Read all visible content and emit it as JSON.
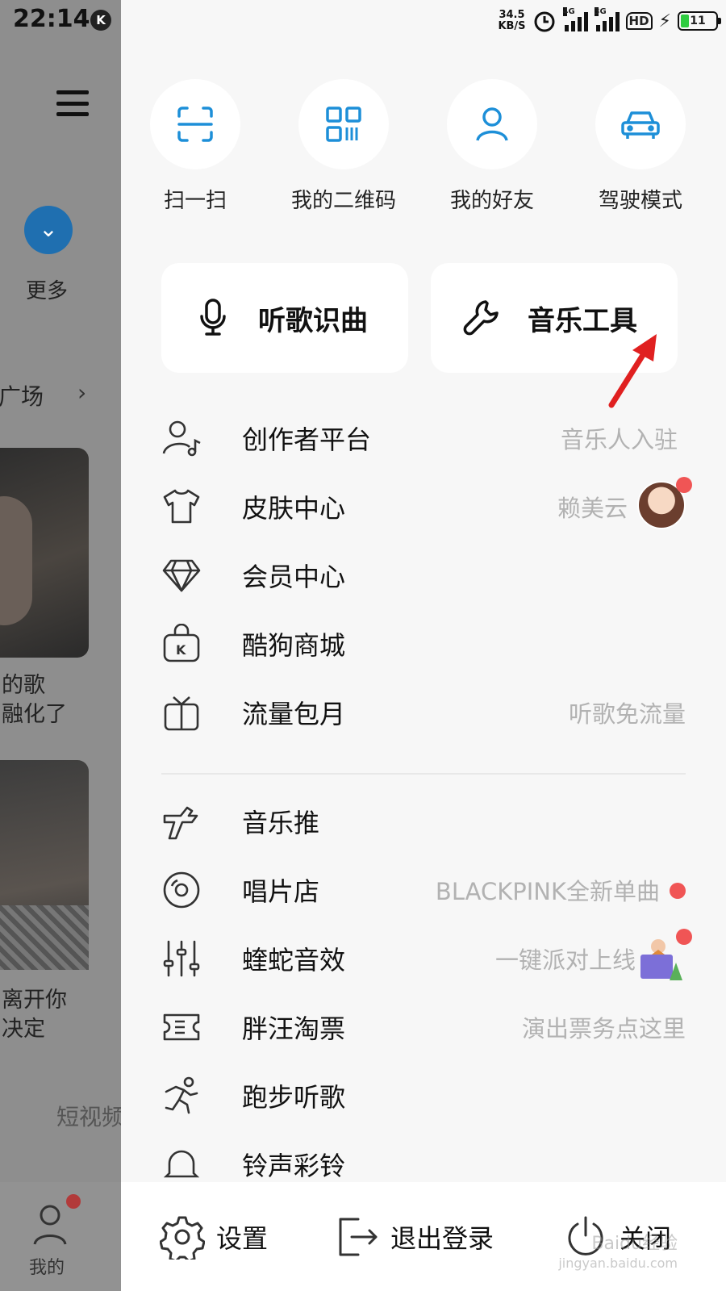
{
  "statusbar": {
    "time": "22:14",
    "badge": "K",
    "netspeed_value": "34.5",
    "netspeed_unit": "KB/S",
    "sim1": "4G",
    "sim2": "3G",
    "hd": "HD",
    "battery": "11"
  },
  "background": {
    "more_label": "更多",
    "square_label": "单广场",
    "caption1_line1": "的歌",
    "caption1_line2": "融化了",
    "caption2_line1": "离开你",
    "caption2_line2": "决定",
    "short_video": "短视频",
    "my_label": "我的"
  },
  "quick_actions": [
    {
      "label": "扫一扫",
      "icon": "scan-icon"
    },
    {
      "label": "我的二维码",
      "icon": "qrcode-icon"
    },
    {
      "label": "我的好友",
      "icon": "friend-icon"
    },
    {
      "label": "驾驶模式",
      "icon": "car-icon"
    }
  ],
  "cards": [
    {
      "label": "听歌识曲",
      "icon": "mic-recognize-icon"
    },
    {
      "label": "音乐工具",
      "icon": "wrench-icon"
    }
  ],
  "menu": [
    {
      "label": "创作者平台",
      "hint": "音乐人入驻",
      "icon": "creator-icon"
    },
    {
      "label": "皮肤中心",
      "hint": "赖美云",
      "icon": "tshirt-icon"
    },
    {
      "label": "会员中心",
      "hint": "",
      "icon": "diamond-icon"
    },
    {
      "label": "酷狗商城",
      "hint": "",
      "icon": "shopping-bag-icon"
    },
    {
      "label": "流量包月",
      "hint": "听歌免流量",
      "icon": "gift-icon"
    },
    {
      "label": "音乐推",
      "hint": "",
      "icon": "music-push-icon"
    },
    {
      "label": "唱片店",
      "hint": "BLACKPINK全新单曲",
      "icon": "vinyl-icon"
    },
    {
      "label": "蝰蛇音效",
      "hint": "一键派对上线",
      "icon": "equalizer-icon"
    },
    {
      "label": "胖汪淘票",
      "hint": "演出票务点这里",
      "icon": "ticket-icon"
    },
    {
      "label": "跑步听歌",
      "hint": "",
      "icon": "running-icon"
    },
    {
      "label": "铃声彩铃",
      "hint": "",
      "icon": "bell-icon"
    }
  ],
  "footer": {
    "settings": "设置",
    "logout": "退出登录",
    "close": "关闭"
  },
  "watermark": {
    "line1": "Baidu经验",
    "line2": "jingyan.baidu.com"
  },
  "colors": {
    "accent": "#1d8fd8",
    "reddot": "#f05555",
    "hint": "#b2b2b2",
    "arrow": "#e02020"
  }
}
